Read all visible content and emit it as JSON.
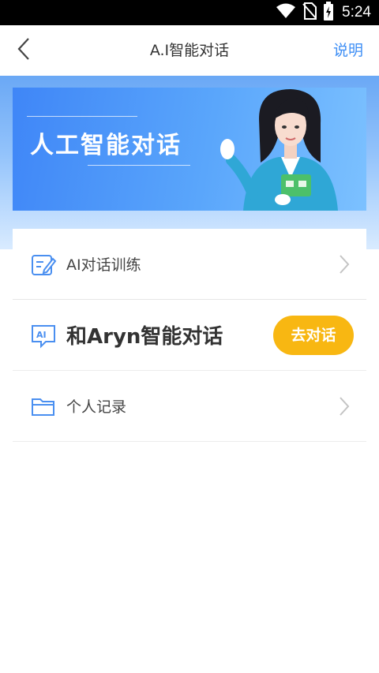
{
  "status_bar": {
    "time": "5:24",
    "icons": [
      "wifi-icon",
      "no-sim-icon",
      "battery-charging-icon"
    ]
  },
  "header": {
    "back_icon": "back-chevron-icon",
    "title": "A.I智能对话",
    "action_label": "说明",
    "action_color": "#3d8ef5"
  },
  "banner": {
    "text": "人工智能对话",
    "figure": "ai-assistant-avatar"
  },
  "menu": {
    "items": [
      {
        "label": "AI对话训练",
        "icon": "edit-note-icon"
      },
      {
        "label": "和Aryn智能对话",
        "icon": "ai-chat-icon",
        "button_label": "去对话",
        "button_color": "#f8b712"
      },
      {
        "label": "个人记录",
        "icon": "folder-icon"
      }
    ]
  },
  "colors": {
    "accent": "#3d8ef5",
    "hero_gradient_top": "#6aa8f5",
    "button_yellow": "#f8b712"
  }
}
